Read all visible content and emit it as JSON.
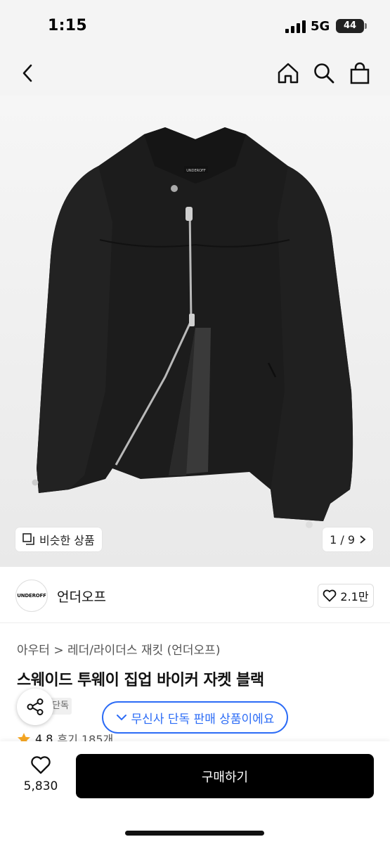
{
  "status_bar": {
    "time": "1:15",
    "network": "5G",
    "battery": "44"
  },
  "nav": {
    "back_icon": "chevron-left-icon",
    "home_icon": "home-icon",
    "search_icon": "search-icon",
    "cart_icon": "shopping-bag-icon"
  },
  "image": {
    "jacket_brand_tag": "UNDEROFF",
    "similar_label": "비슷한 상품",
    "counter": "1 / 9"
  },
  "brand": {
    "logo_text": "UNDEROFF",
    "name": "언더오프",
    "likes": "2.1만"
  },
  "product": {
    "breadcrumb": "아우터 > 레더/라이더스 재킷 (언더오프)",
    "title": "스웨이드 투웨이 집업 바이커 자켓 블랙",
    "exclusive_tag": "단독",
    "rating": "4.8",
    "reviews": "후기 185개"
  },
  "toast": {
    "text": "무신사 단독 판매 상품이에요"
  },
  "bottom_bar": {
    "wish_count": "5,830",
    "buy_label": "구매하기"
  },
  "colors": {
    "accent": "#2c6cf6",
    "buy_button": "#000000",
    "star": "#f5a623"
  }
}
